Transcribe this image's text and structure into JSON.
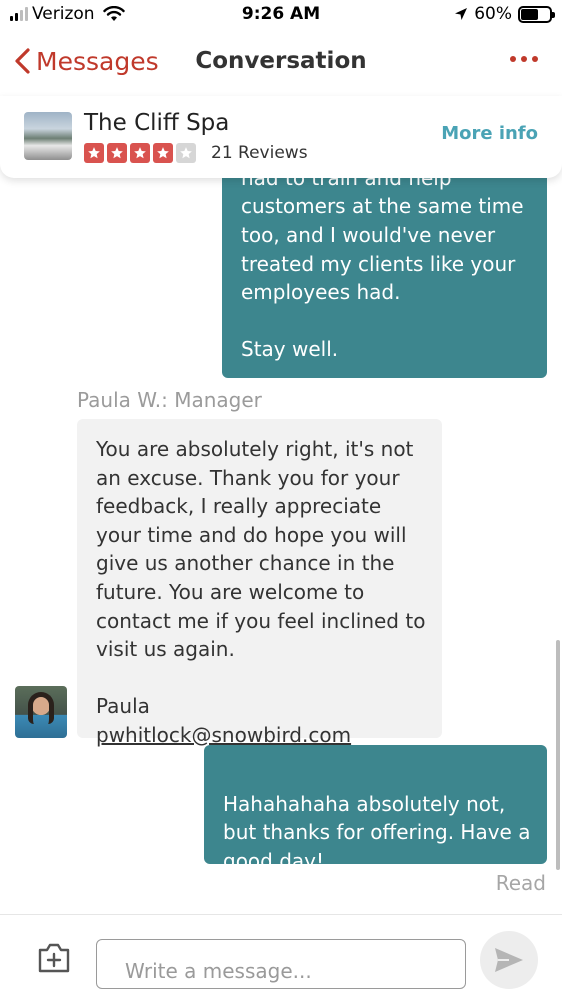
{
  "status_bar": {
    "carrier": "Verizon",
    "time": "9:26 AM",
    "battery": "60%",
    "battery_level": 0.6,
    "signal_bars": 2,
    "icons": [
      "signal-icon",
      "wifi-icon",
      "location-arrow-icon",
      "battery-icon"
    ]
  },
  "nav": {
    "back_label": "Messages",
    "title": "Conversation",
    "icons": [
      "chevron-left-icon",
      "more-dots-icon"
    ]
  },
  "business": {
    "name": "The Cliff Spa",
    "rating": 4,
    "rating_max": 5,
    "reviews": "21 Reviews",
    "more_info": "More info"
  },
  "messages": [
    {
      "direction": "outgoing",
      "text": "had to train and help customers at the same time too, and I would've never treated my clients like your employees had.\n\nStay well."
    },
    {
      "direction": "incoming",
      "sender": "Paula W.: Manager",
      "text": "You are absolutely right, it's not an excuse. Thank you for your feedback, I really appreciate your time and do hope you will give us another chance in the future. You are welcome to contact me if you feel inclined to visit us again.\n\nPaula",
      "email": "pwhitlock@snowbird.com"
    },
    {
      "direction": "outgoing",
      "text": "Hahahahaha absolutely not, but thanks for offering. Have a good day!"
    }
  ],
  "read_receipt": "Read",
  "composer": {
    "placeholder": "Write a message...",
    "icons": [
      "camera-plus-icon",
      "send-icon"
    ]
  },
  "colors": {
    "accent_red": "#c0392b",
    "link_teal": "#4aa3b5",
    "outgoing_bubble": "#3d868e",
    "incoming_bubble": "#f2f2f2",
    "star_filled": "#d9534f",
    "star_empty": "#d6d6d6"
  }
}
